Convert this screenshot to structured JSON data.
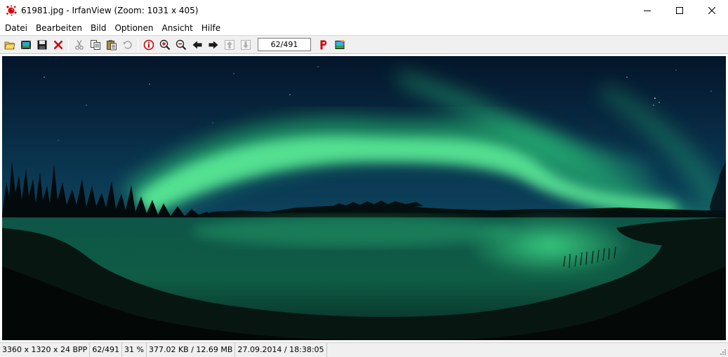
{
  "window": {
    "title": "61981.jpg - IrfanView (Zoom: 1031 x 405)",
    "app_icon": "irfanview-splat-icon",
    "controls": [
      "minimize-icon",
      "maximize-icon",
      "close-icon"
    ]
  },
  "menu": {
    "items": [
      {
        "label": "Datei"
      },
      {
        "label": "Bearbeiten"
      },
      {
        "label": "Bild"
      },
      {
        "label": "Optionen"
      },
      {
        "label": "Ansicht"
      },
      {
        "label": "Hilfe"
      }
    ]
  },
  "toolbar": {
    "page_field_value": "62/491",
    "icons": [
      "open-folder-icon",
      "slideshow-icon",
      "save-icon",
      "delete-icon",
      "cut-icon",
      "copy-icon",
      "paste-icon",
      "undo-icon",
      "info-icon",
      "zoom-in-icon",
      "zoom-out-icon",
      "previous-arrow-icon",
      "next-arrow-icon",
      "first-file-icon",
      "last-file-icon",
      "print-p-icon",
      "paint-icon"
    ]
  },
  "status": {
    "dimensions": "3360 x 1320 x 24 BPP",
    "position": "62/491",
    "zoom": "31 %",
    "size": "377.02 KB / 12.69 MB",
    "datetime": "27.09.2014 / 18:38:05"
  },
  "colors": {
    "accent_red": "#cc0000",
    "aurora_green": "#3df28a",
    "sky_dark": "#05182a",
    "water_green": "#1a7a55"
  }
}
